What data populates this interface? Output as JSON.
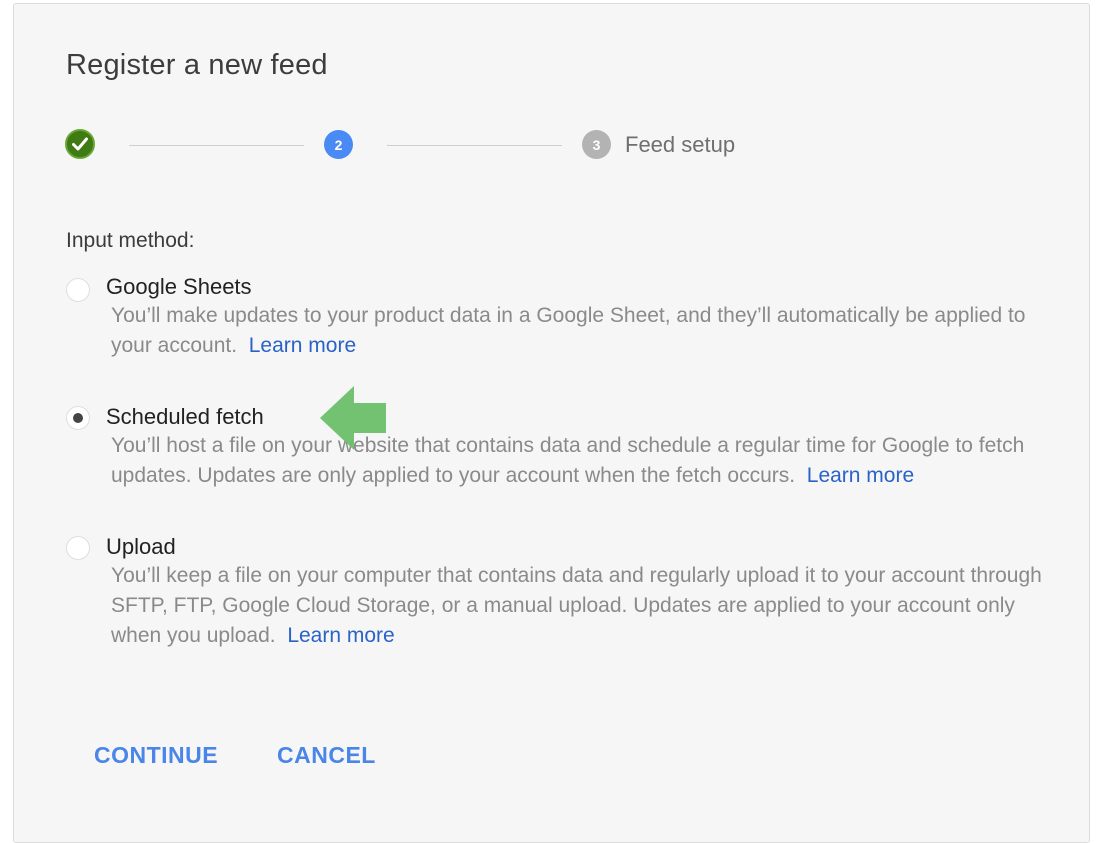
{
  "dialog": {
    "title": "Register a new feed"
  },
  "stepper": {
    "steps": [
      {
        "number": "✓",
        "state": "complete",
        "icon": "check-icon"
      },
      {
        "number": "2",
        "state": "active"
      },
      {
        "number": "3",
        "state": "upcoming",
        "label": "Feed setup"
      }
    ]
  },
  "input_method": {
    "label": "Input method:",
    "selected": "scheduled_fetch",
    "options": [
      {
        "title": "Google Sheets",
        "description": "You’ll make updates to your product data in a Google Sheet, and they’ll automatically be applied to your account.",
        "link": "Learn more",
        "checked": false
      },
      {
        "title": "Scheduled fetch",
        "description": "You’ll host a file on your website that contains data and schedule a regular time for Google to fetch updates. Updates are only applied to your account when the fetch occurs.",
        "link": "Learn more",
        "checked": true
      },
      {
        "title": "Upload",
        "description": "You’ll keep a file on your computer that contains data and regularly upload it to your account through SFTP, FTP, Google Cloud Storage, or a manual upload. Updates are applied to your account only when you upload.",
        "link": "Learn more",
        "checked": false
      }
    ]
  },
  "actions": {
    "continue_label": "CONTINUE",
    "cancel_label": "CANCEL"
  },
  "annotation": {
    "icon": "left-arrow-icon",
    "color": "#6abf69"
  },
  "colors": {
    "accent": "#4a86e8",
    "link": "#2a62c9",
    "step_complete": "#3f7a12",
    "step_active": "#4a8af4",
    "step_upcoming": "#b3b3b3"
  }
}
